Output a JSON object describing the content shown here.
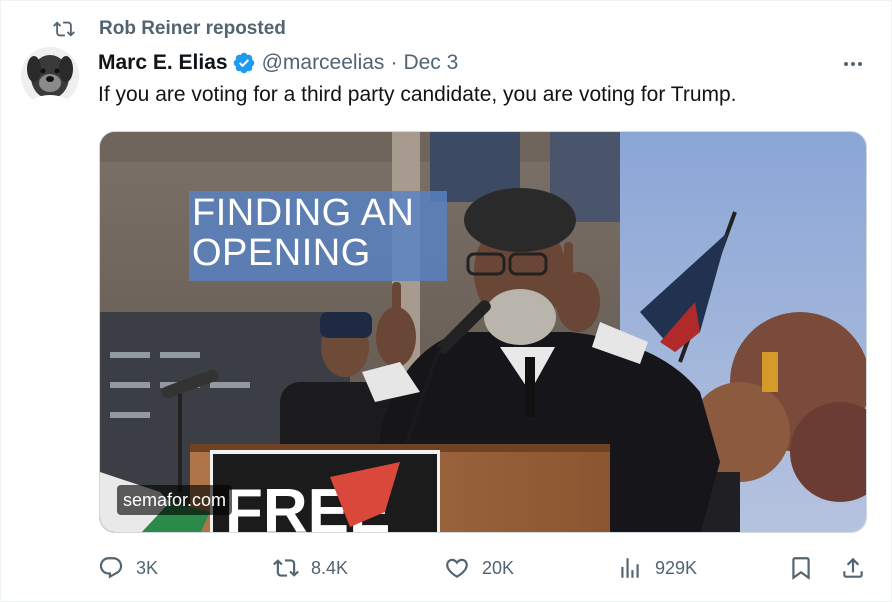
{
  "repost": {
    "icon": "repost-icon",
    "text": "Rob Reiner reposted"
  },
  "author": {
    "avatar": "avatar",
    "name": "Marc E. Elias",
    "verified_icon": "verified-badge-icon",
    "verified_color": "#1d9bf0",
    "handle": "@marceelias",
    "separator": "·",
    "date": "Dec 3"
  },
  "more_icon": "more-options-icon",
  "tweet": {
    "text": "If you are voting for a third party candidate, you are voting for Trump."
  },
  "media": {
    "headline": [
      "FINDING AN",
      "OPENING"
    ],
    "source": "semafor.com",
    "podium_sign": "FREE"
  },
  "actions": {
    "reply": {
      "icon": "reply-icon",
      "count": "3K"
    },
    "repost": {
      "icon": "repost-icon",
      "count": "8.4K"
    },
    "like": {
      "icon": "heart-icon",
      "count": "20K"
    },
    "views": {
      "icon": "views-chart-icon",
      "count": "929K"
    },
    "bookmark": {
      "icon": "bookmark-icon"
    },
    "share": {
      "icon": "share-icon"
    }
  },
  "colors": {
    "text_primary": "#0f1419",
    "text_secondary": "#536471",
    "border": "#eff3f4"
  }
}
